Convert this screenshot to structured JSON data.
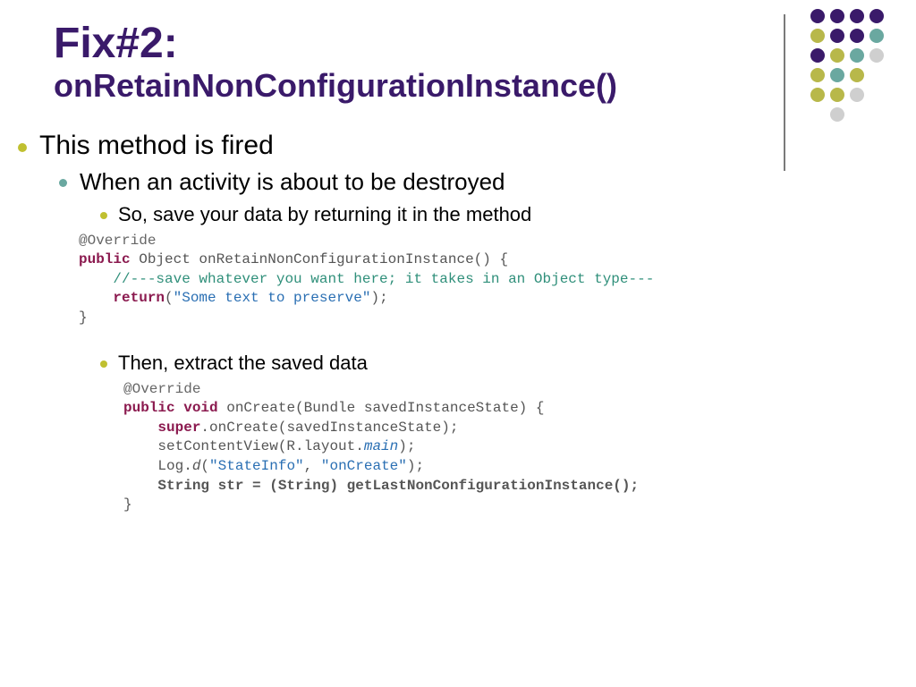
{
  "title": {
    "line1": "Fix#2:",
    "line2": "onRetainNonConfigurationInstance()"
  },
  "bullets": {
    "l1": "This method is fired",
    "l2": "When an activity is about to be destroyed",
    "l3a": "So, save your data by returning it in the method",
    "l3b": "Then, extract the saved data"
  },
  "code1": {
    "override": "@Override",
    "public": "public",
    "sig_rest": " Object onRetainNonConfigurationInstance() {",
    "comment": "    //---save whatever you want here; it takes in an Object type---",
    "return_kw": "    return",
    "return_str": "\"Some text to preserve\"",
    "return_end": ");",
    "close": "}"
  },
  "code2": {
    "override": "@Override",
    "public": "public",
    "void": " void",
    "sig_rest": " onCreate(Bundle savedInstanceState) {",
    "super_kw": "    super",
    "super_rest": ".onCreate(savedInstanceState);",
    "setcv_a": "    setContentView(R.layout.",
    "setcv_main": "main",
    "setcv_b": ");",
    "log_a": "    Log.",
    "log_d": "d",
    "log_b": "(",
    "log_s1": "\"StateInfo\"",
    "log_comma": ", ",
    "log_s2": "\"onCreate\"",
    "log_c": ");",
    "strline": "    String str = (String) getLastNonConfigurationInstance();",
    "close": "}"
  },
  "decor": {
    "rows": [
      [
        "c-purple",
        "c-purple",
        "c-purple",
        "c-purple"
      ],
      [
        "c-olive",
        "c-purple",
        "c-purple",
        "c-teal"
      ],
      [
        "c-purple",
        "c-olive",
        "c-teal",
        "c-lgrey"
      ],
      [
        "c-olive",
        "c-teal",
        "c-olive",
        "c-none"
      ],
      [
        "c-olive",
        "c-olive",
        "c-lgrey",
        "c-none"
      ],
      [
        "c-none",
        "c-lgrey",
        "c-none",
        "c-none"
      ]
    ]
  }
}
